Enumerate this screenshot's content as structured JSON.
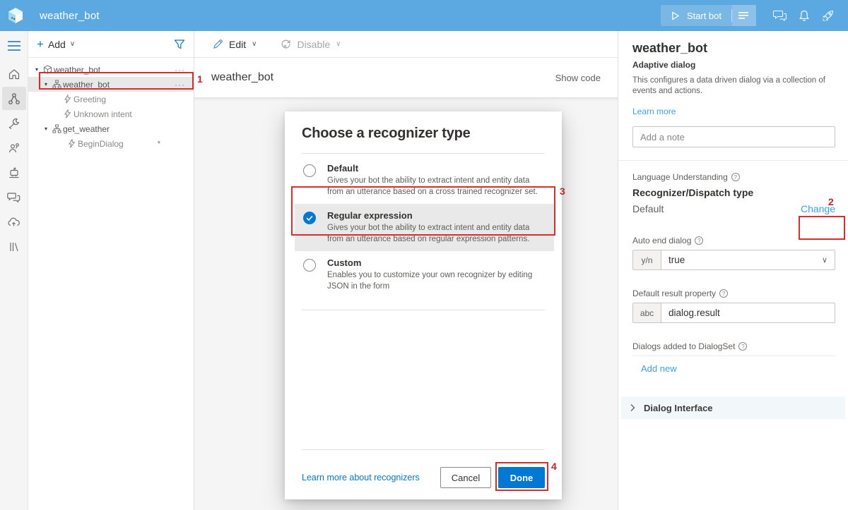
{
  "topbar": {
    "title": "weather_bot",
    "start_bot": "Start bot"
  },
  "glyphs": {
    "caret_down": "▾",
    "chevron_down": "∨",
    "ellipsis": "···",
    "plus": "+",
    "help": "?"
  },
  "tree": {
    "add_label": "Add",
    "modified_marker": "*",
    "items": [
      {
        "label": "weather_bot",
        "type": "bot-project"
      },
      {
        "label": "weather_bot",
        "type": "dialog",
        "selected": true
      },
      {
        "label": "Greeting",
        "type": "trigger"
      },
      {
        "label": "Unknown intent",
        "type": "trigger"
      },
      {
        "label": "get_weather",
        "type": "dialog"
      },
      {
        "label": "BeginDialog",
        "type": "trigger",
        "modified": true
      }
    ]
  },
  "toolbar": {
    "edit": "Edit",
    "disable": "Disable"
  },
  "main": {
    "title": "weather_bot",
    "show_code": "Show code"
  },
  "modal": {
    "title": "Choose a recognizer type",
    "options": [
      {
        "label": "Default",
        "description": "Gives your bot the ability to extract intent and entity data from an utterance based on a cross trained recognizer set.",
        "selected": false
      },
      {
        "label": "Regular expression",
        "description": "Gives your bot the ability to extract intent and entity data from an utterance based on regular expression patterns.",
        "selected": true
      },
      {
        "label": "Custom",
        "description": "Enables you to customize your own recognizer by editing JSON in the form",
        "selected": false
      }
    ],
    "link": "Learn more about recognizers",
    "cancel": "Cancel",
    "done": "Done"
  },
  "props": {
    "title": "weather_bot",
    "subtitle": "Adaptive dialog",
    "description": "This configures a data driven dialog via a collection of events and actions.",
    "learn_more": "Learn more",
    "note_placeholder": "Add a note",
    "lu_label": "Language Understanding",
    "recognizer_label": "Recognizer/Dispatch type",
    "recognizer_value": "Default",
    "change_label": "Change",
    "auto_end_label": "Auto end dialog",
    "auto_end_prefix": "y/n",
    "auto_end_value": "true",
    "result_label": "Default result property",
    "result_prefix": "abc",
    "result_value": "dialog.result",
    "dialogset_label": "Dialogs added to DialogSet",
    "add_new": "Add new",
    "dialog_interface": "Dialog Interface"
  },
  "annotations": {
    "n1": "1",
    "n2": "2",
    "n3": "3",
    "n4": "4"
  },
  "colors": {
    "accent": "#0078d4",
    "topbar": "#5ca8e0",
    "annotation": "#dd2b2b",
    "link_light": "#3aa0f3"
  }
}
